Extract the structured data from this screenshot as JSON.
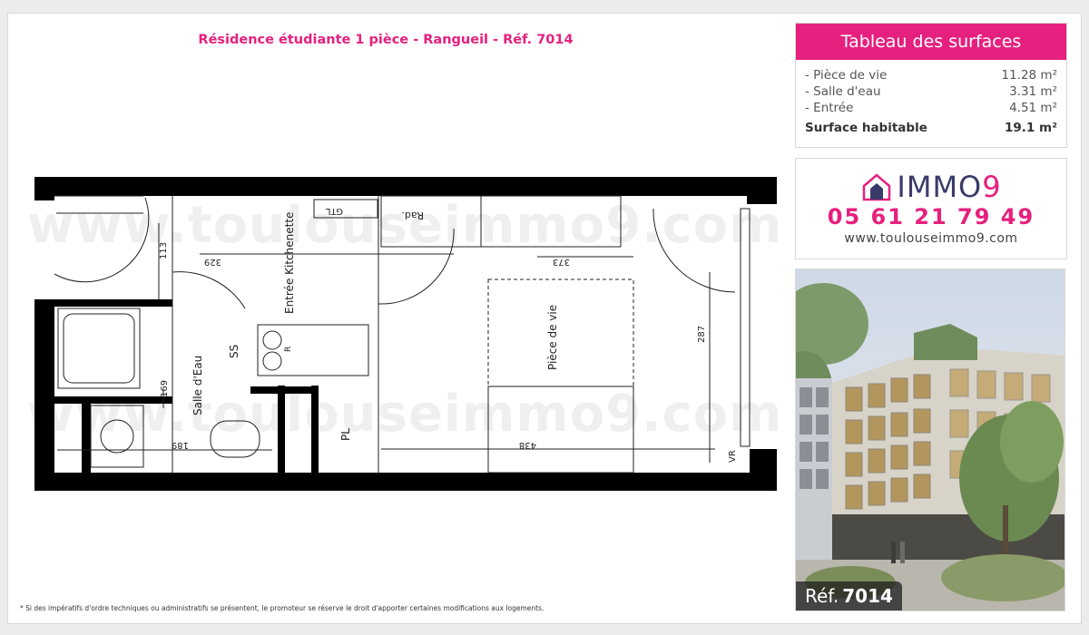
{
  "listing": {
    "title": "Résidence étudiante 1 pièce - Rangueil - Réf. 7014",
    "footnote": "* Si des impératifs d'ordre techniques ou administratifs se présentent, le promoteur se réserve le droit d'apporter certaines modifications aux logements."
  },
  "surfaces": {
    "heading": "Tableau des surfaces",
    "rows": [
      {
        "label": "- Pièce de vie",
        "value": "11.28 m²"
      },
      {
        "label": "- Salle d'eau",
        "value": "3.31 m²"
      },
      {
        "label": "- Entrée",
        "value": "4.51 m²"
      }
    ],
    "total": {
      "label": "Surface habitable",
      "value": "19.1 m²"
    }
  },
  "contact": {
    "brand": "IMMO",
    "brand_digit": "9",
    "phone": "05 61 21 79 49",
    "website": "www.toulouseimmo9.com"
  },
  "watermark": "www.toulouseimmo9.com",
  "plan": {
    "rooms": {
      "entree_kitchenette": "Entrée Kitchenette",
      "salle_eau": "Salle d'Eau",
      "piece_vie": "Pièce de vie",
      "ss": "SS",
      "pl": "PL",
      "gtl": "GTL",
      "rad": "Rad.",
      "vr": "VR",
      "r": "R"
    },
    "dimensions": {
      "d113": "113",
      "d329": "329",
      "d373": "373",
      "d287": "287",
      "d169": "169",
      "d189": "189",
      "d438": "438"
    }
  },
  "photo": {
    "ref_label": "Réf.",
    "ref_number": "7014"
  },
  "colors": {
    "accent": "#e6207e",
    "brand_dark": "#3a3a6a"
  }
}
